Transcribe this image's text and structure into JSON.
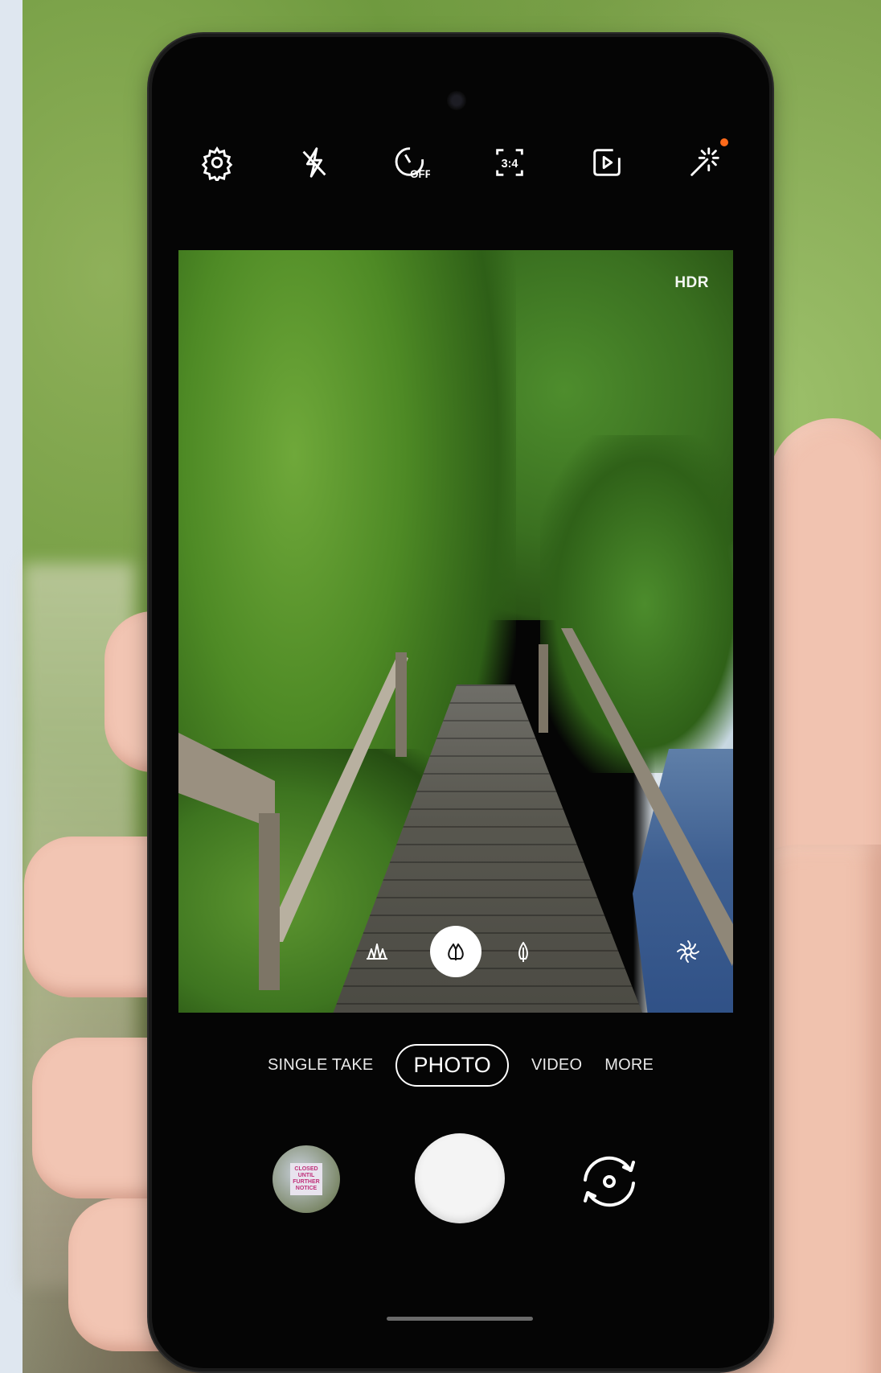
{
  "camera": {
    "hdr_label": "HDR",
    "top_controls": [
      {
        "name": "settings",
        "icon": "gear-icon"
      },
      {
        "name": "flash",
        "icon": "flash-off-icon"
      },
      {
        "name": "timer",
        "icon": "timer-off-icon",
        "label": "OFF"
      },
      {
        "name": "ratio",
        "icon": "aspect-ratio-icon",
        "label": "3:4"
      },
      {
        "name": "motion-photo",
        "icon": "motion-photo-icon"
      },
      {
        "name": "effects",
        "icon": "sparkle-icon",
        "indicator_color": "#ff6a1a"
      }
    ],
    "zoom_filters": [
      {
        "icon": "ultra-wide-trees-icon",
        "active": false
      },
      {
        "icon": "wide-tree-icon",
        "active": true
      },
      {
        "icon": "tele-tree-icon",
        "active": false
      }
    ],
    "scene_optimizer_icon": "scene-optimizer-icon",
    "modes": [
      {
        "label": "SINGLE TAKE",
        "selected": false
      },
      {
        "label": "PHOTO",
        "selected": true
      },
      {
        "label": "VIDEO",
        "selected": false
      },
      {
        "label": "MORE",
        "selected": false
      }
    ],
    "gallery_thumbnail_text": "CLOSED UNTIL FURTHER NOTICE",
    "bottom_controls": {
      "gallery": "gallery-thumbnail",
      "shutter": "shutter-button",
      "flip": "flip-camera-icon"
    }
  }
}
